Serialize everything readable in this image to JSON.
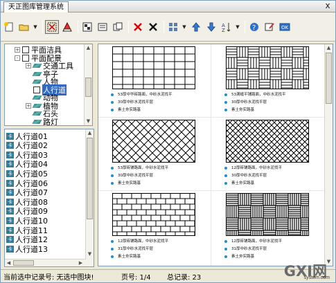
{
  "window": {
    "title": "天正图库管理系统",
    "close_glyph": "x"
  },
  "toolbar": {
    "buttons": [
      {
        "name": "new-library-icon"
      },
      {
        "name": "open-library-icon",
        "has_dropdown": true
      },
      {
        "name": "select-all-icon",
        "pressed": true
      },
      {
        "name": "pick-icon"
      },
      {
        "name": "batch-load-icon"
      },
      {
        "name": "save-icon"
      },
      {
        "name": "replace-icon"
      },
      {
        "name": "delete-red-x-icon"
      },
      {
        "name": "delete-black-x-icon"
      },
      {
        "name": "view-grid-icon",
        "has_dropdown": true
      },
      {
        "name": "move-up-icon"
      },
      {
        "name": "move-down-icon"
      },
      {
        "name": "sort-icon",
        "has_dropdown": true
      },
      {
        "name": "help-icon"
      },
      {
        "name": "edit-icon"
      },
      {
        "name": "ok-icon"
      }
    ]
  },
  "tree": {
    "items": [
      {
        "label": "平面洁具",
        "level": 1,
        "expand": "+",
        "icon": "book"
      },
      {
        "label": "平面配景",
        "level": 1,
        "expand": "-",
        "icon": "book"
      },
      {
        "label": "交通工具",
        "level": 2,
        "expand": "+",
        "icon": "diamond"
      },
      {
        "label": "亭子",
        "level": 2,
        "expand": "",
        "icon": "diamond"
      },
      {
        "label": "人物",
        "level": 2,
        "expand": "",
        "icon": "diamond"
      },
      {
        "label": "人行道",
        "level": 2,
        "expand": "",
        "icon": "book",
        "selected": true
      },
      {
        "label": "动物",
        "level": 2,
        "expand": "",
        "icon": "diamond"
      },
      {
        "label": "植物",
        "level": 2,
        "expand": "+",
        "icon": "diamond"
      },
      {
        "label": "石头",
        "level": 2,
        "expand": "",
        "icon": "diamond"
      },
      {
        "label": "路灯",
        "level": 2,
        "expand": "",
        "icon": "diamond"
      }
    ]
  },
  "list": {
    "items": [
      "人行道01",
      "人行道02",
      "人行道03",
      "人行道04",
      "人行道05",
      "人行道06",
      "人行道07",
      "人行道08",
      "人行道09",
      "人行道10",
      "人行道11",
      "人行道12",
      "人行道13"
    ],
    "icon_glyph": "卡"
  },
  "preview": {
    "cells": [
      {
        "pattern": "stack-bond",
        "captions": [
          "53厚中华砖路面，中砂水泥找平",
          "30厚中砂水泥找平层",
          "素土夯实路基"
        ]
      },
      {
        "pattern": "basket-weave",
        "captions": [
          "53满缝平铺路面，中砂水泥找平",
          "30厚中砂水泥找平层",
          "素土夯实路基"
        ]
      },
      {
        "pattern": "herringbone",
        "captions": [
          "53厚砖铺路面，中砂水泥找平",
          "30厚中砂水泥找平层",
          "素土夯实路基"
        ]
      },
      {
        "pattern": "herringbone-fine",
        "captions": [
          "12厚砖铺路面，中砂水泥找平",
          "30厚中砂水泥找平层",
          "素土夯实路基"
        ]
      },
      {
        "pattern": "running-bond",
        "captions": [
          "12厚砖铺路面，中砂水泥找平",
          "31厚中砂水泥找平层",
          "素土夯实路基"
        ]
      },
      {
        "pattern": "parquet",
        "captions": [
          "12厚砖铺路面，中砂水泥找平",
          "31厚中砂水泥找平层",
          "素土夯实路基"
        ]
      }
    ]
  },
  "status": {
    "current_record": "当前选中记录号: 无选中图块!",
    "page": "页号:  1/4",
    "total": "总记录:  23"
  },
  "watermark": {
    "main": "GXI网",
    "sub": "system.com"
  }
}
